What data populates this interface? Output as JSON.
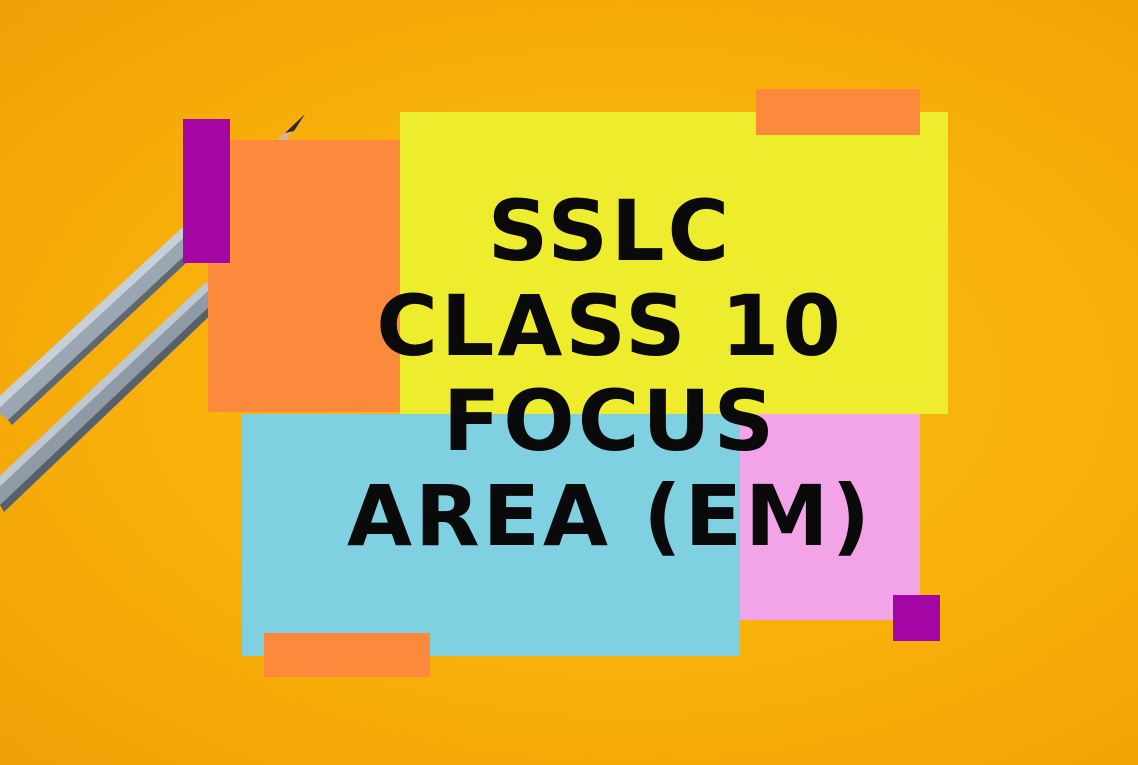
{
  "title": {
    "lines": [
      "SSLC",
      "CLASS 10",
      "FOCUS",
      "AREA (EM)"
    ]
  },
  "colors": {
    "background": "#f7ae0a",
    "note_orange": "#fb8a3c",
    "note_yellow": "#eeed2d",
    "note_blue": "#7fd0e0",
    "note_pink": "#f3a4e8",
    "note_purple": "#a406a5",
    "text": "#0a0a0a",
    "pencil": "#8e9aa6"
  }
}
